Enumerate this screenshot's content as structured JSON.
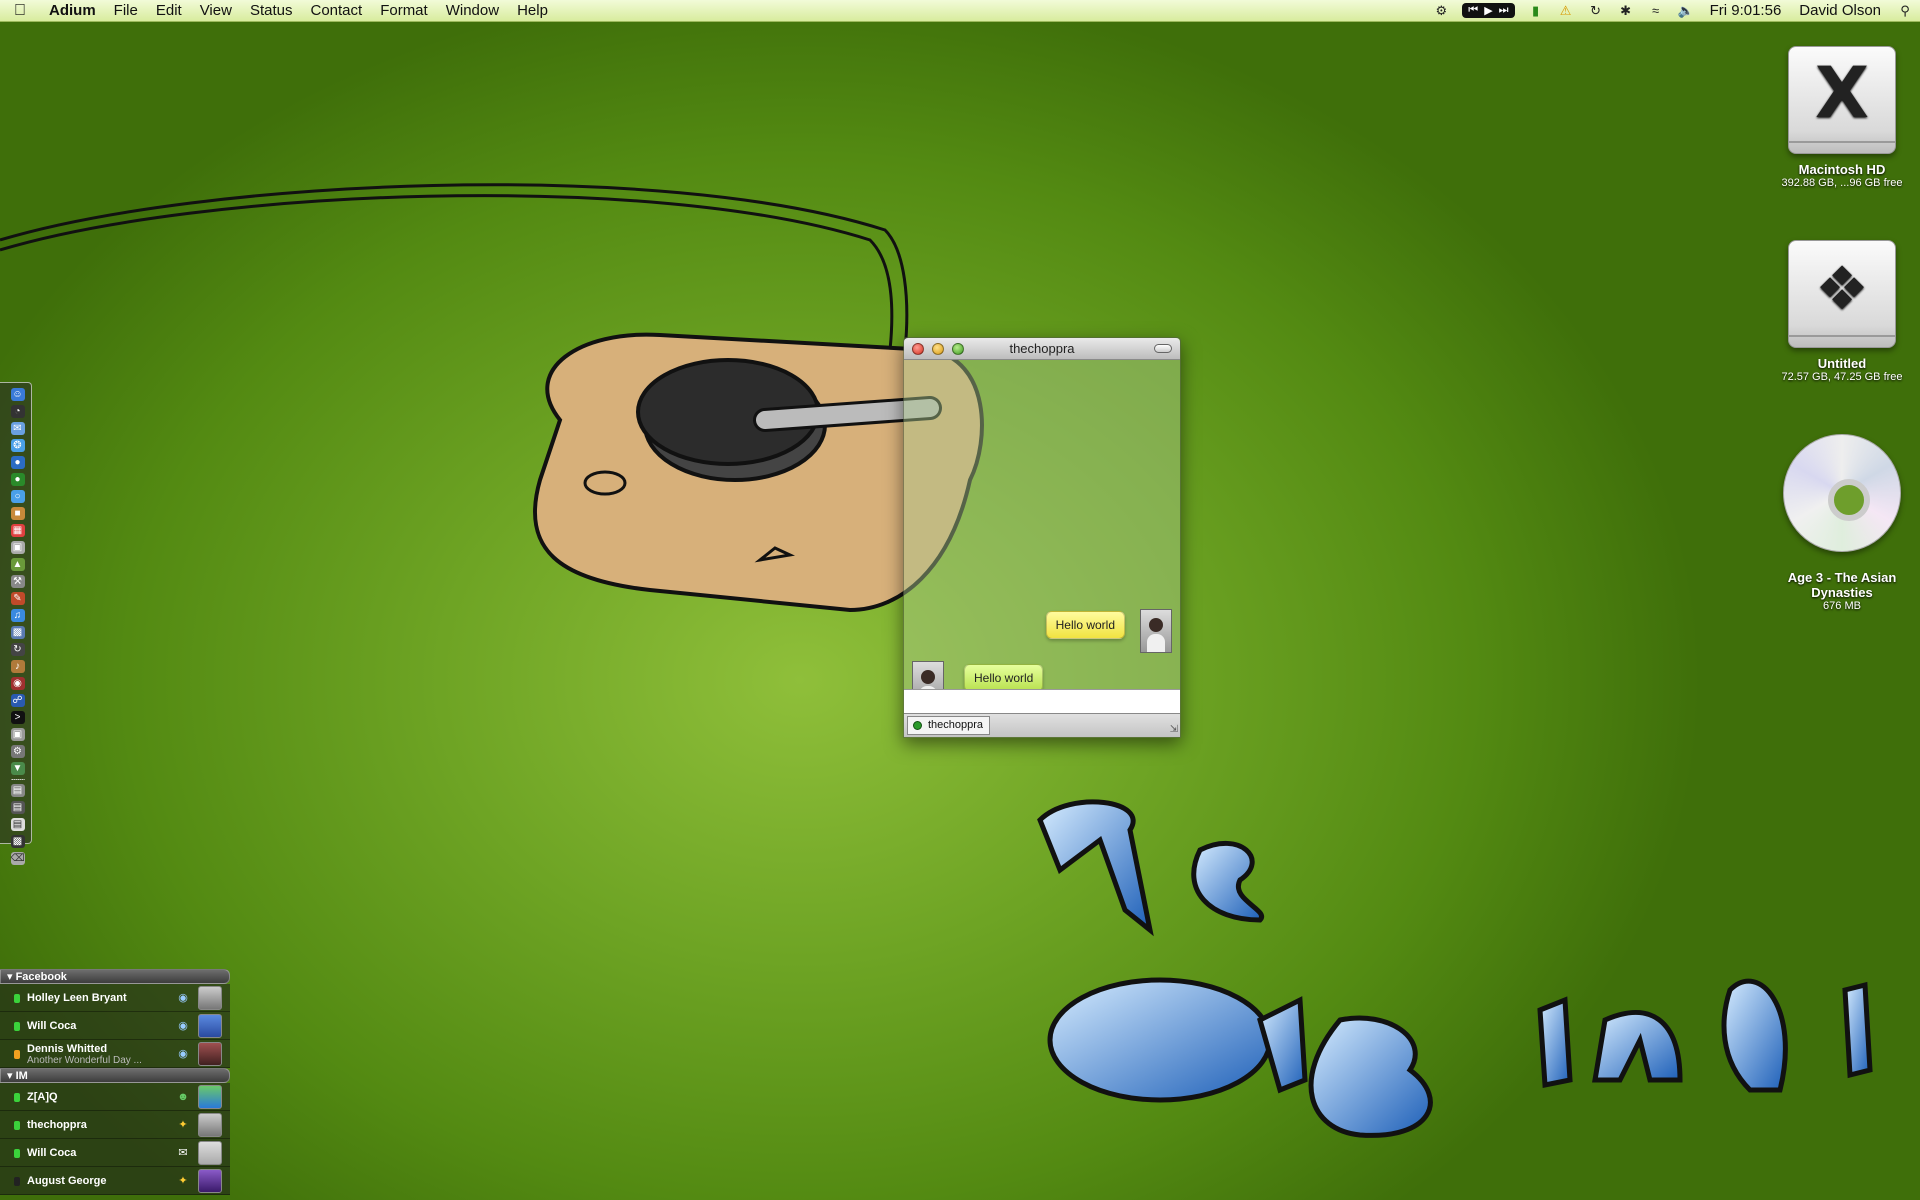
{
  "menubar": {
    "apple_icon": "apple-icon",
    "app_name": "Adium",
    "menus": [
      "File",
      "Edit",
      "View",
      "Status",
      "Contact",
      "Format",
      "Window",
      "Help"
    ],
    "clock": "Fri 9:01:56",
    "user": "David Olson"
  },
  "desktop": {
    "icons": [
      {
        "name": "Macintosh HD",
        "sub": "392.88 GB, ...96 GB free"
      },
      {
        "name": "Untitled",
        "sub": "72.57 GB, 47.25 GB free"
      },
      {
        "name": "Age 3 - The Asian Dynasties",
        "sub": "676 MB"
      }
    ]
  },
  "chat": {
    "title": "thechoppra",
    "outgoing_message": "Hello world",
    "incoming_message": "Hello world",
    "tab_label": "thechoppra"
  },
  "contacts": {
    "groups": [
      {
        "name": "Facebook",
        "contacts": [
          {
            "name": "Holley Leen Bryant",
            "status": ""
          },
          {
            "name": "Will Coca",
            "status": ""
          },
          {
            "name": "Dennis Whitted",
            "status": "Another Wonderful Day ..."
          }
        ]
      },
      {
        "name": "IM",
        "contacts": [
          {
            "name": "Z[A]Q",
            "status": ""
          },
          {
            "name": "thechoppra",
            "status": ""
          },
          {
            "name": "Will Coca",
            "status": ""
          },
          {
            "name": "August George",
            "status": ""
          }
        ]
      }
    ]
  },
  "colors": {
    "desktop_green": "#6ea424",
    "bubble_yellow": "#f1e341",
    "bubble_green": "#b8e14e",
    "graffiti_blue": "#2a7fd0"
  }
}
